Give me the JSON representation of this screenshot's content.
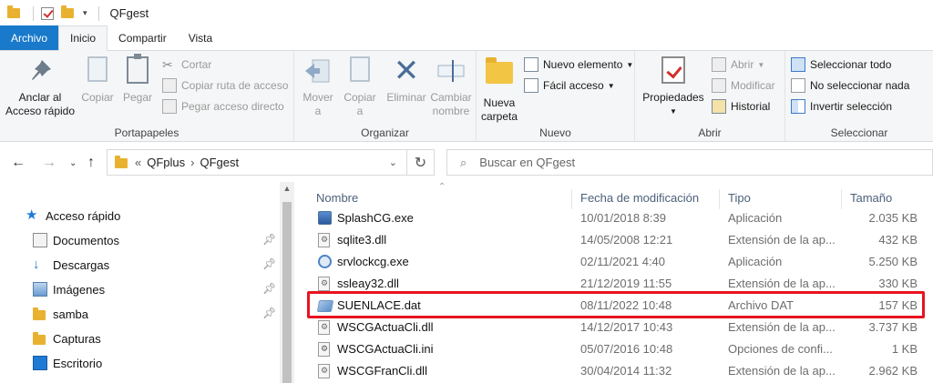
{
  "window": {
    "title": "QFgest"
  },
  "tabs": [
    "Archivo",
    "Inicio",
    "Compartir",
    "Vista"
  ],
  "ribbon": {
    "portapapeles": {
      "label": "Portapapeles",
      "anclar": "Anclar al\nAcceso rápido",
      "anclar_l1": "Anclar al",
      "anclar_l2": "Acceso rápido",
      "copiar": "Copiar",
      "pegar": "Pegar",
      "cortar": "Cortar",
      "copiar_ruta": "Copiar ruta de acceso",
      "pegar_acceso": "Pegar acceso directo"
    },
    "organizar": {
      "label": "Organizar",
      "mover_l1": "Mover",
      "mover_l2": "a",
      "copiar_l1": "Copiar",
      "copiar_l2": "a",
      "eliminar": "Eliminar",
      "cambiar_l1": "Cambiar",
      "cambiar_l2": "nombre"
    },
    "nuevo": {
      "label": "Nuevo",
      "nueva_l1": "Nueva",
      "nueva_l2": "carpeta",
      "nuevo_elemento": "Nuevo elemento",
      "facil_acceso": "Fácil acceso"
    },
    "abrir": {
      "label": "Abrir",
      "propiedades": "Propiedades",
      "abrir": "Abrir",
      "modificar": "Modificar",
      "historial": "Historial"
    },
    "seleccionar": {
      "label": "Seleccionar",
      "todo": "Seleccionar todo",
      "ninguno": "No seleccionar nada",
      "invertir": "Invertir selección"
    }
  },
  "address": {
    "prefix": "«",
    "crumb1": "QFplus",
    "sep": "›",
    "crumb2": "QFgest",
    "search_placeholder": "Buscar en QFgest"
  },
  "navpane": [
    {
      "label": "Acceso rápido",
      "icon": "star-icon",
      "pinned": false
    },
    {
      "label": "Documentos",
      "icon": "documents-icon",
      "pinned": true
    },
    {
      "label": "Descargas",
      "icon": "download-icon",
      "pinned": true
    },
    {
      "label": "Imágenes",
      "icon": "pictures-icon",
      "pinned": true
    },
    {
      "label": "samba",
      "icon": "folder-icon",
      "pinned": true
    },
    {
      "label": "Capturas",
      "icon": "folder-icon",
      "pinned": false
    },
    {
      "label": "Escritorio",
      "icon": "desktop-icon",
      "pinned": false
    }
  ],
  "columns": {
    "name": "Nombre",
    "date": "Fecha de modificación",
    "type": "Tipo",
    "size": "Tamaño"
  },
  "files": [
    {
      "name": "SplashCG.exe",
      "date": "10/01/2018 8:39",
      "type": "Aplicación",
      "size": "2.035 KB",
      "icon": "exe"
    },
    {
      "name": "sqlite3.dll",
      "date": "14/05/2008 12:21",
      "type": "Extensión de la ap...",
      "size": "432 KB",
      "icon": "dll"
    },
    {
      "name": "srvlockcg.exe",
      "date": "02/11/2021 4:40",
      "type": "Aplicación",
      "size": "5.250 KB",
      "icon": "srv"
    },
    {
      "name": "ssleay32.dll",
      "date": "21/12/2019 11:55",
      "type": "Extensión de la ap...",
      "size": "330 KB",
      "icon": "dll"
    },
    {
      "name": "SUENLACE.dat",
      "date": "08/11/2022 10:48",
      "type": "Archivo DAT",
      "size": "157 KB",
      "icon": "dat"
    },
    {
      "name": "WSCGActuaCli.dll",
      "date": "14/12/2017 10:43",
      "type": "Extensión de la ap...",
      "size": "3.737 KB",
      "icon": "dll"
    },
    {
      "name": "WSCGActuaCli.ini",
      "date": "05/07/2016 10:48",
      "type": "Opciones de confi...",
      "size": "1 KB",
      "icon": "ini"
    },
    {
      "name": "WSCGFranCli.dll",
      "date": "30/04/2014 11:32",
      "type": "Extensión de la ap...",
      "size": "2.962 KB",
      "icon": "dll"
    }
  ]
}
